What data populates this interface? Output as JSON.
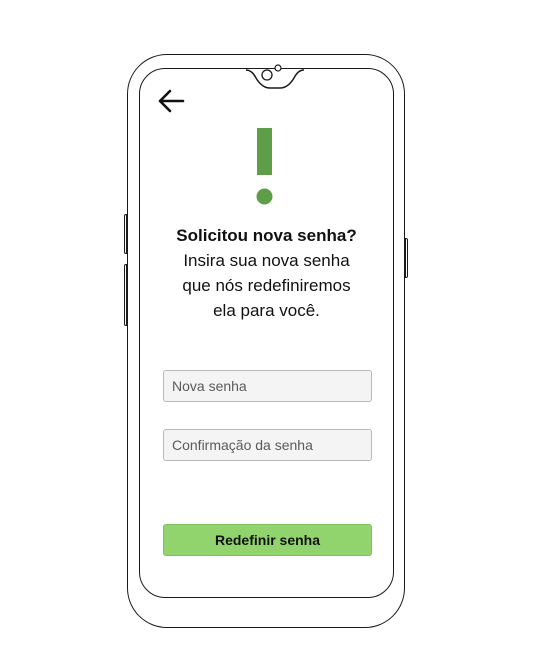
{
  "header": {
    "back_icon": "arrow-left-icon"
  },
  "alert": {
    "icon": "exclamation-icon",
    "color": "#5f9e48"
  },
  "content": {
    "title": "Solicitou nova senha?",
    "subtitle_lines": [
      "Insira sua nova senha",
      "que nós redefiniremos",
      "ela para você."
    ]
  },
  "form": {
    "new_password": {
      "placeholder": "Nova senha",
      "value": ""
    },
    "confirm_password": {
      "placeholder": "Confirmação da senha",
      "value": ""
    },
    "submit_label": "Redefinir senha",
    "submit_color": "#91d46d"
  }
}
